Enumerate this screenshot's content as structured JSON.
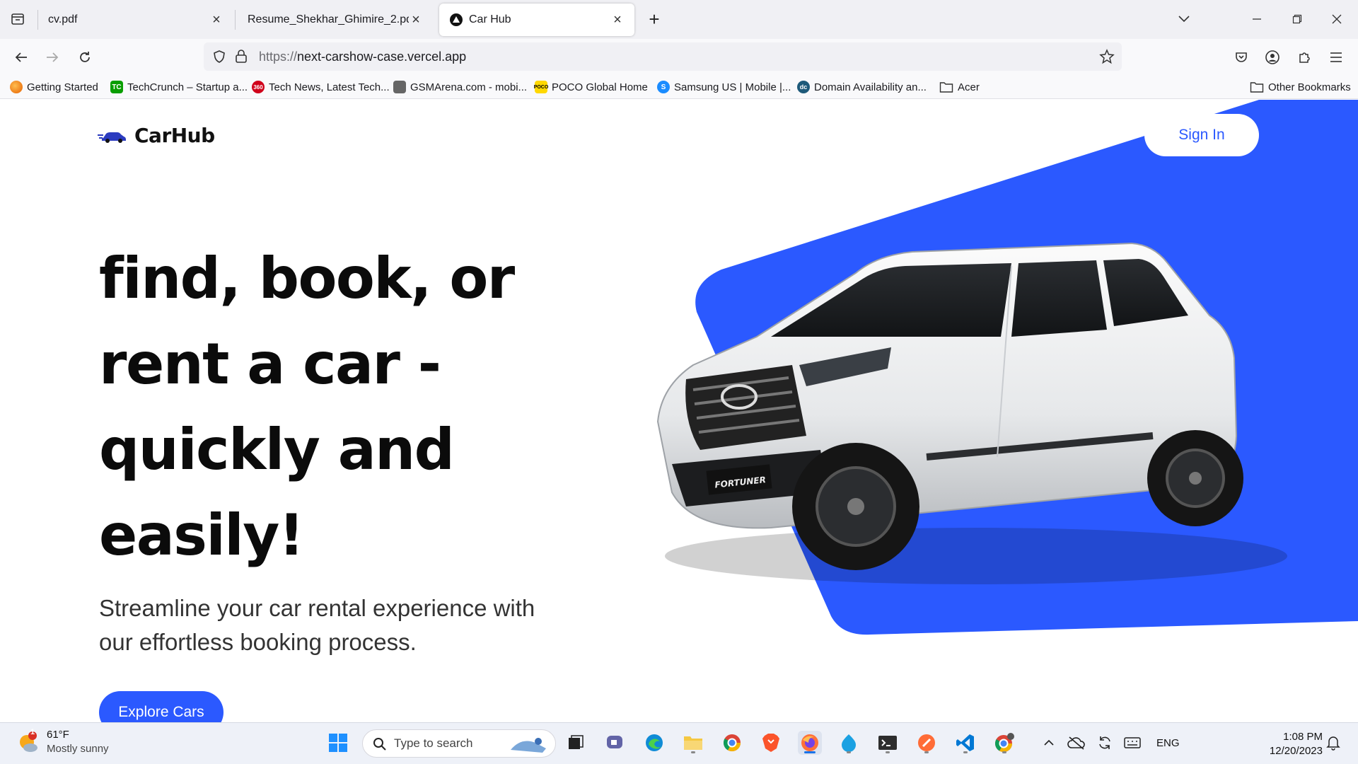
{
  "tabs": [
    {
      "title": "cv.pdf",
      "active": false
    },
    {
      "title": "Resume_Shekhar_Ghimire_2.pdf",
      "active": false
    },
    {
      "title": "Car Hub",
      "active": true
    }
  ],
  "url": {
    "protocol": "https://",
    "host": "next-carshow-case.vercel.app"
  },
  "bookmarks": [
    {
      "label": "Getting Started",
      "icon": "firefox-icon"
    },
    {
      "label": "TechCrunch – Startup a...",
      "icon": "techcrunch-icon"
    },
    {
      "label": "Tech News, Latest Tech...",
      "icon": "news-icon"
    },
    {
      "label": "GSMArena.com - mobi...",
      "icon": "gsmarena-icon"
    },
    {
      "label": "POCO Global Home",
      "icon": "poco-icon"
    },
    {
      "label": "Samsung US | Mobile |...",
      "icon": "samsung-icon"
    },
    {
      "label": "Domain Availability an...",
      "icon": "domain-icon"
    },
    {
      "label": "Acer",
      "icon": "folder-icon"
    },
    {
      "label": "Other Bookmarks",
      "icon": "folder-icon"
    }
  ],
  "page": {
    "logo": "CarHub",
    "signin": "Sign In",
    "headline": "find, book, or rent a car - quickly and easily!",
    "subtitle": "Streamline your car rental experience with our effortless booking process.",
    "cta": "Explore Cars",
    "accent": "#2b59ff"
  },
  "taskbar": {
    "weather_temp": "61°F",
    "weather_desc": "Mostly sunny",
    "weather_badge": "1",
    "search_placeholder": "Type to search",
    "language": "ENG",
    "time": "1:08 PM",
    "date": "12/20/2023"
  }
}
